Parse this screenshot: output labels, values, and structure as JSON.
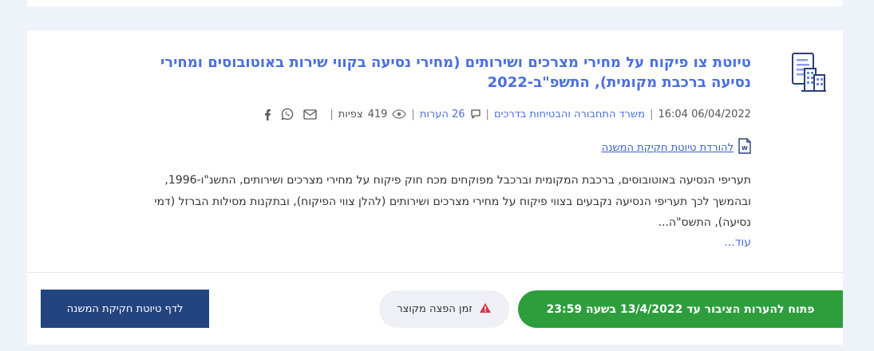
{
  "item": {
    "title": "טיוטת צו פיקוח על מחירי מצרכים ושירותים (מחירי נסיעה בקווי שירות באוטובוסים ומחירי נסיעה ברכבת מקומית), התשפ\"ב-2022",
    "date": "06/04/2022 16:04",
    "ministry": "משרד התחבורה והבטיחות בדרכים",
    "comments": "26 הערות",
    "views_count": "419",
    "views_label": "צפיות",
    "download_label": "להורדת טיוטת חקיקת המשנה",
    "summary": "תעריפי הנסיעה באוטובוסים, ברכבת המקומית וברכבל מפוקחים מכח חוק פיקוח על מחירי מצרכים ושירותים, התשנ\"ו-1996, ובהמשך לכך תעריפי הנסיעה נקבעים בצווי פיקוח על מחירי מצרכים ושירותים (להלן צווי הפיקוח), ובתקנות מסילות הברזל (דמי נסיעה), התשס\"ה...",
    "more_label": "עוד...",
    "status_open": "פתוח להערות הציבור עד 13/4/2022 בשעה 23:59",
    "short_label": "זמן הפצה מקוצר",
    "go_button": "לדף טיוטת חקיקת המשנה"
  },
  "icons": [
    "document-building-icon",
    "comment-icon",
    "eye-icon",
    "email-icon",
    "whatsapp-icon",
    "facebook-icon",
    "word-file-icon",
    "warning-icon"
  ],
  "colors": {
    "title": "#4a6fe0",
    "open_green": "#2e9e3c",
    "button_navy": "#24447f",
    "warning_red": "#d8334a"
  }
}
